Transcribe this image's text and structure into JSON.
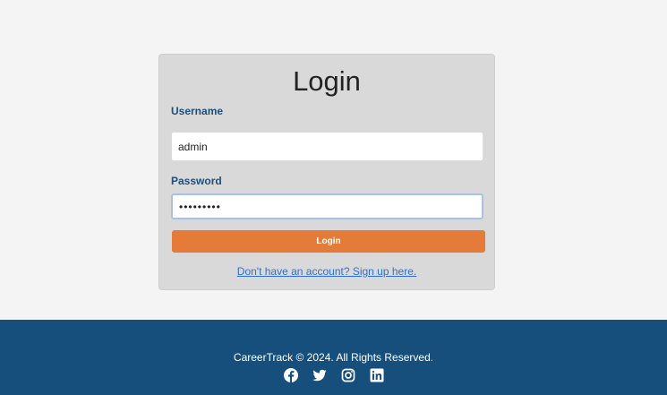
{
  "login": {
    "title": "Login",
    "username_label": "Username",
    "username_value": "admin",
    "password_label": "Password",
    "password_value": "•••••••••",
    "submit_label": "Login",
    "signup_link": "Don't have an account? Sign up here."
  },
  "footer": {
    "copyright": "CareerTrack © 2024. All Rights Reserved.",
    "social_icons": [
      "facebook-icon",
      "twitter-icon",
      "instagram-icon",
      "linkedin-icon"
    ]
  },
  "colors": {
    "accent": "#e57b39",
    "footer_bg": "#174f7c",
    "label": "#1f4e78",
    "link": "#2f6fd6",
    "card_bg": "#d9d9d9",
    "page_bg": "#f4f4f4"
  }
}
